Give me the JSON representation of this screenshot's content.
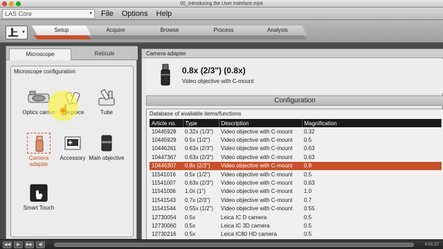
{
  "window": {
    "title": "00_Introducing the User Interface.mp4"
  },
  "app_select": {
    "value": "LAS Core"
  },
  "menu": [
    "File",
    "Options",
    "Help"
  ],
  "workflow_steps": [
    {
      "label": "Setup",
      "active": true
    },
    {
      "label": "Acquire",
      "active": false
    },
    {
      "label": "Browse",
      "active": false
    },
    {
      "label": "Process",
      "active": false
    },
    {
      "label": "Analysis",
      "active": false
    }
  ],
  "left_tabs": {
    "active": "Microscope",
    "inactive": "Reticule"
  },
  "config": {
    "title": "Microscope configuration",
    "tools": [
      {
        "label": "Optics carrier",
        "icon": "optics-carrier-icon"
      },
      {
        "label": "Eyepiece",
        "icon": "eyepiece-icon"
      },
      {
        "label": "Tube",
        "icon": "tube-icon"
      },
      {
        "label": "Camera adapter",
        "icon": "camera-adapter-icon",
        "selected": true
      },
      {
        "label": "Accessory",
        "icon": "accessory-icon"
      },
      {
        "label": "Main objective",
        "icon": "main-objective-icon"
      },
      {
        "label": "Smart Touch",
        "icon": "smart-touch-icon"
      }
    ]
  },
  "adapter": {
    "header": "Camera adapter",
    "name": "0.8x (2/3\") (0.8x)",
    "description": "Video objective with C-mount"
  },
  "configuration_label": "Configuration",
  "database": {
    "title": "Database of available items/functions",
    "columns": [
      "Article no.",
      "Type",
      "Description",
      "Magnification"
    ],
    "rows": [
      [
        "10445928",
        "0.32x (1/3\")",
        "Video objective with C-mount",
        "0.32"
      ],
      [
        "10445929",
        "0.5x (1/2\")",
        "Video objective with C-mount",
        "0.5"
      ],
      [
        "10446261",
        "0.63x (2/3\")",
        "Video objective with C-mount",
        "0.63"
      ],
      [
        "10447367",
        "0.63x (2/3\")",
        "Video objective with C-mount",
        "0.63"
      ],
      [
        "10446307",
        "0.8x (2/3\")",
        "Video objective with C-mount",
        "0.8"
      ],
      [
        "11541016",
        "0.5x (1/2\")",
        "Video objective with C-mount",
        "0.5"
      ],
      [
        "11541007",
        "0.63x (2/3\")",
        "Video objective with C-mount",
        "0.63"
      ],
      [
        "11541006",
        "1.0x (1\")",
        "Video objective with C-mount",
        "1.0"
      ],
      [
        "11541543",
        "0.7x (2/3\")",
        "Video objective with C-mount",
        "0.7"
      ],
      [
        "11541544",
        "0.55x (1/2\")",
        "Video objective with C-mount",
        "0.55"
      ],
      [
        "12730054",
        "0.5x",
        "Leica IC D camera",
        "0.5"
      ],
      [
        "12730060",
        "0.5x",
        "Leica IC 3D camera",
        "0.5"
      ],
      [
        "12730216",
        "0.5x",
        "Leica IC80 HD camera",
        "0.5"
      ]
    ],
    "selected_row": 4
  },
  "player": {
    "time": "0:01:27"
  },
  "colors": {
    "accent": "#c8502a",
    "highlight": "#f8f43c"
  }
}
